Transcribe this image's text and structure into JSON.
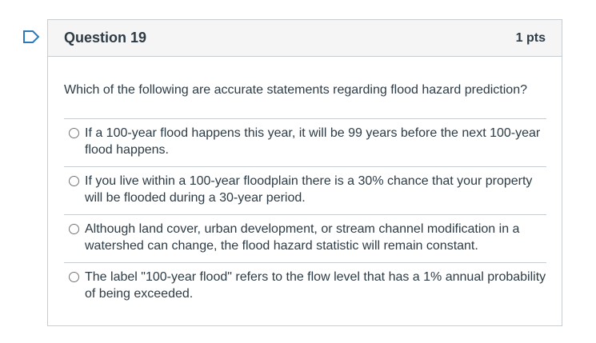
{
  "quiz": {
    "title": "Question 19",
    "points": "1 pts",
    "prompt": "Which of the following are accurate statements regarding flood hazard prediction?",
    "answers": [
      {
        "label": "If a 100-year flood happens this year, it will be 99 years before the next 100-year flood happens."
      },
      {
        "label": "If you live within a 100-year floodplain there is a 30% chance that your property will be flooded during a 30-year period."
      },
      {
        "label": "Although land cover, urban development, or stream channel modification in a watershed can change, the flood hazard statistic will remain constant."
      },
      {
        "label": "The label \"100-year flood\" refers to the flow level that has a 1% annual probability of being exceeded."
      }
    ]
  },
  "icons": {
    "flag": "flag-icon"
  }
}
